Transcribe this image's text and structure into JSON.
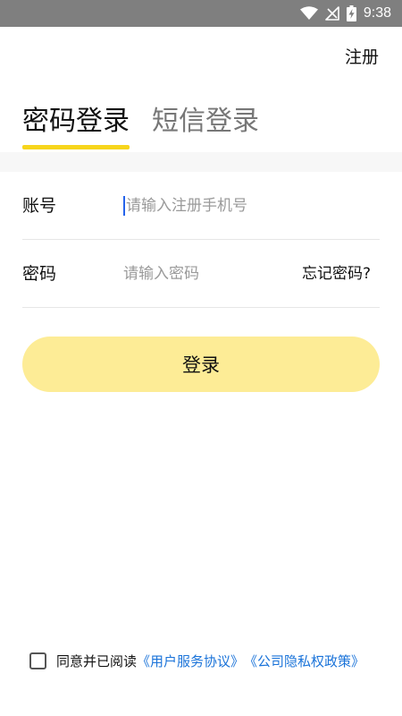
{
  "status_bar": {
    "time": "9:38",
    "icons": [
      "wifi-icon",
      "no-signal-icon",
      "battery-charging-icon"
    ]
  },
  "header": {
    "register_label": "注册"
  },
  "tabs": [
    {
      "label": "密码登录",
      "active": true
    },
    {
      "label": "短信登录",
      "active": false
    }
  ],
  "form": {
    "account": {
      "label": "账号",
      "placeholder": "请输入注册手机号",
      "value": ""
    },
    "password": {
      "label": "密码",
      "placeholder": "请输入密码",
      "value": "",
      "forgot_label": "忘记密码?"
    },
    "submit_label": "登录"
  },
  "agreement": {
    "checked": false,
    "text": "同意并已阅读",
    "user_agreement": "《用户服务协议》",
    "privacy_policy": "《公司隐私权政策》"
  },
  "colors": {
    "accent": "#f7d51c",
    "button_bg": "#fdec96",
    "link": "#1a73d9",
    "status_bar_bg": "#7f7f7f"
  }
}
